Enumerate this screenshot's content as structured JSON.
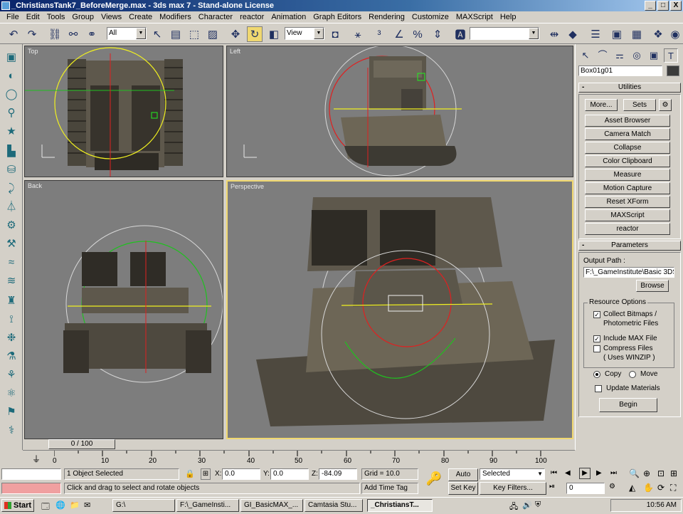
{
  "window": {
    "title": "_ChristiansTank7_BeforeMerge.max - 3ds max 7 - Stand-alone License",
    "controls": [
      "_",
      "□",
      "X"
    ]
  },
  "menu": [
    "File",
    "Edit",
    "Tools",
    "Group",
    "Views",
    "Create",
    "Modifiers",
    "Character",
    "reactor",
    "Animation",
    "Graph Editors",
    "Rendering",
    "Customize",
    "MAXScript",
    "Help"
  ],
  "toolbar": {
    "selection_filter": "All",
    "ref_coord": "View",
    "named_selection": ""
  },
  "viewports": {
    "top": "Top",
    "left": "Left",
    "back": "Back",
    "perspective": "Perspective"
  },
  "command_panel": {
    "object_name": "Box01g01",
    "utilities": {
      "title": "Utilities",
      "more": "More...",
      "sets": "Sets",
      "buttons": [
        "Asset Browser",
        "Camera Match",
        "Collapse",
        "Color Clipboard",
        "Measure",
        "Motion Capture",
        "Reset XForm",
        "MAXScript",
        "reactor"
      ]
    },
    "parameters": {
      "title": "Parameters",
      "output_path_label": "Output Path :",
      "output_path": "F:\\_GameInstitute\\Basic 3DS",
      "browse": "Browse",
      "resource_options": "Resource Options",
      "collect_bitmaps": "Collect Bitmaps /",
      "collect_bitmaps_2": "Photometric Files",
      "include_max": "Include MAX File",
      "compress_files": "Compress Files",
      "compress_files_2": "( Uses WINZIP )",
      "copy": "Copy",
      "move": "Move",
      "update_materials": "Update Materials",
      "begin": "Begin"
    }
  },
  "timeline": {
    "frame": "0 / 100",
    "ticks": [
      "0",
      "10",
      "20",
      "30",
      "40",
      "50",
      "60",
      "70",
      "80",
      "90",
      "100"
    ]
  },
  "status": {
    "selected": "1 Object Selected",
    "prompt": "Click and drag to select and rotate objects",
    "x_label": "X:",
    "x": "0.0",
    "y_label": "Y:",
    "y": "0.0",
    "z_label": "Z:",
    "z": "-84.09",
    "grid": "Grid = 10.0",
    "add_time_tag": "Add Time Tag",
    "auto_key": "Auto Key",
    "set_key": "Set Key",
    "key_mode": "Selected",
    "key_filters": "Key Filters...",
    "current_frame": "0"
  },
  "taskbar": {
    "start": "Start",
    "tasks": [
      "G:\\",
      "F:\\_GameInsti...",
      "GI_BasicMAX_...",
      "Camtasia Stu...",
      "_ChristiansT..."
    ],
    "clock": "10:56 AM"
  },
  "colors": {
    "viewport_bg": "#7d7d7d",
    "active_viewport_border": "#f0d870",
    "gizmo_red": "#e02020",
    "gizmo_green": "#20c020",
    "gizmo_yellow": "#f0f020"
  }
}
